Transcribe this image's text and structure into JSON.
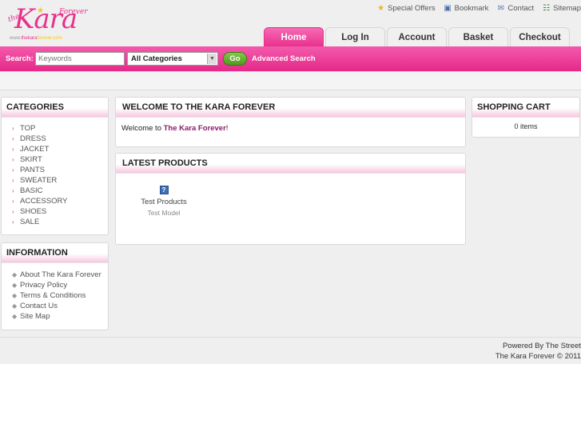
{
  "logo": {
    "the": "the",
    "kara": "Kara",
    "forever": "Forever",
    "www_pre": "www.",
    "www_brand": "the",
    "www_mid": "kara",
    "www_post": "forever.com"
  },
  "toplinks": [
    {
      "label": "Special Offers",
      "icon": "star-icon"
    },
    {
      "label": "Bookmark",
      "icon": "bookmark-icon"
    },
    {
      "label": "Contact",
      "icon": "mail-icon"
    },
    {
      "label": "Sitemap",
      "icon": "sitemap-icon"
    }
  ],
  "tabs": [
    "Home",
    "Log In",
    "Account",
    "Basket",
    "Checkout"
  ],
  "search": {
    "label": "Search:",
    "placeholder": "Keywords",
    "category": "All Categories",
    "go": "Go",
    "advanced": "Advanced Search"
  },
  "categories": {
    "title": "CATEGORIES",
    "items": [
      "TOP",
      "DRESS",
      "JACKET",
      "SKIRT",
      "PANTS",
      "SWEATER",
      "BASIC",
      "ACCESSORY",
      "SHOES",
      "SALE"
    ]
  },
  "information": {
    "title": "INFORMATION",
    "items": [
      "About The Kara Forever",
      "Privacy Policy",
      "Terms & Conditions",
      "Contact Us",
      "Site Map"
    ]
  },
  "welcome": {
    "title": "WELCOME TO THE KARA FOREVER",
    "text_prefix": "Welcome to ",
    "text_brand": "The Kara Forever",
    "text_suffix": "!"
  },
  "latest": {
    "title": "LATEST PRODUCTS",
    "product_name": "Test Products",
    "product_model": "Test Model",
    "thumb_glyph": "?"
  },
  "cart": {
    "title": "SHOPPING CART",
    "items": "0 items"
  },
  "footer": {
    "powered": "Powered By The Street",
    "copyright": "The Kara Forever © 2011"
  },
  "colors": {
    "accent": "#e8318c",
    "go": "#5fae2b",
    "brand_text": "#8a1a6a"
  }
}
